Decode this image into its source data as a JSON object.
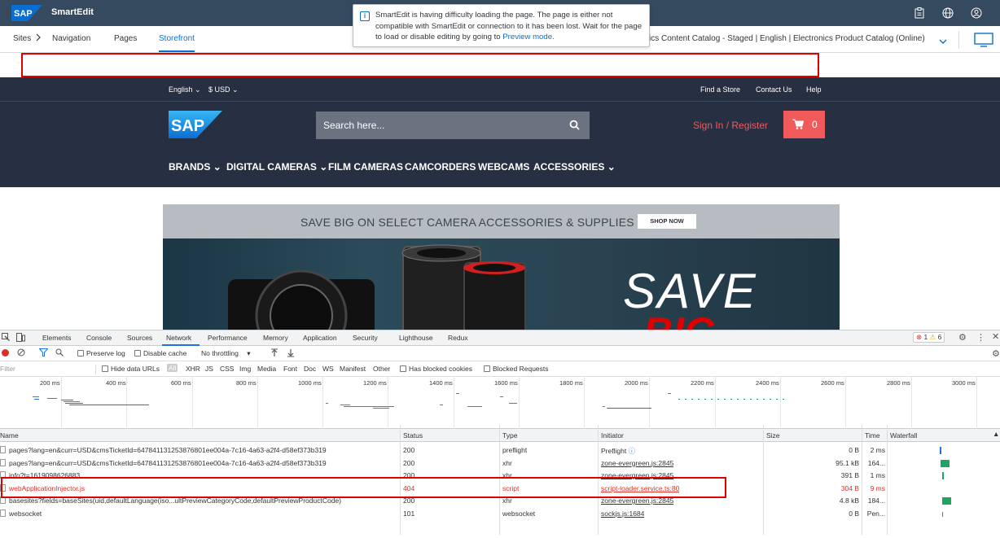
{
  "topbar": {
    "logo_text": "SAP",
    "app_title": "SmartEdit"
  },
  "navbar": {
    "sites_label": "Sites",
    "navigation_label": "Navigation",
    "pages_label": "Pages",
    "storefront_label": "Storefront",
    "catalog_text": "ics Content Catalog - Staged | English | Electronics Product Catalog (Online)"
  },
  "toast": {
    "message": "SmartEdit is having difficulty loading the page. The page is either not compatible with SmartEdit or connection to it has been lost. Wait for the page to load or disable editing by going to ",
    "link": "Preview mode."
  },
  "storefront": {
    "language": "English",
    "currency": "$ USD",
    "find_store": "Find a Store",
    "contact_us": "Contact Us",
    "help": "Help",
    "logo_text": "SAP",
    "search_placeholder": "Search here...",
    "signin": "Sign In / Register",
    "cart_count": "0",
    "categories": [
      "BRANDS",
      "DIGITAL CAMERAS",
      "FILM CAMERAS",
      "CAMCORDERS",
      "WEBCAMS",
      "ACCESSORIES"
    ],
    "banner_text": "SAVE BIG ON SELECT CAMERA ACCESSORIES & SUPPLIES",
    "shop_now": "SHOP NOW",
    "banner_save": "SAVE",
    "banner_big": "BIG"
  },
  "devtools": {
    "tabs": [
      "Elements",
      "Console",
      "Sources",
      "Network",
      "Performance",
      "Memory",
      "Application",
      "Security",
      "Lighthouse",
      "Redux"
    ],
    "active_tab": "Network",
    "error_count": "1",
    "warning_count": "6",
    "toolbar": {
      "preserve_log": "Preserve log",
      "disable_cache": "Disable cache",
      "throttling": "No throttling"
    },
    "filter": {
      "placeholder": "Filter",
      "hide_data_urls": "Hide data URLs",
      "types": [
        "All",
        "XHR",
        "JS",
        "CSS",
        "Img",
        "Media",
        "Font",
        "Doc",
        "WS",
        "Manifest",
        "Other"
      ],
      "blocked_cookies": "Has blocked cookies",
      "blocked_requests": "Blocked Requests"
    },
    "timeline_ticks": [
      "200 ms",
      "400 ms",
      "600 ms",
      "800 ms",
      "1000 ms",
      "1200 ms",
      "1400 ms",
      "1600 ms",
      "1800 ms",
      "2000 ms",
      "2200 ms",
      "2400 ms",
      "2600 ms",
      "2800 ms",
      "3000 ms"
    ],
    "columns": {
      "name": "Name",
      "status": "Status",
      "type": "Type",
      "initiator": "Initiator",
      "size": "Size",
      "time": "Time",
      "waterfall": "Waterfall"
    },
    "rows": [
      {
        "name": "pages?lang=en&curr=USD&cmsTicketId=647841131253876801ee004a-7c16-4a63-a2f4-d58ef373b319",
        "status": "200",
        "type": "preflight",
        "initiator": "Preflight",
        "size": "0 B",
        "time": "2 ms"
      },
      {
        "name": "pages?lang=en&curr=USD&cmsTicketId=647841131253876801ee004a-7c16-4a63-a2f4-d58ef373b319",
        "status": "200",
        "type": "xhr",
        "initiator": "zone-evergreen.js:2845",
        "size": "95.1 kB",
        "time": "164..."
      },
      {
        "name": "info?t=1619098626883",
        "status": "200",
        "type": "xhr",
        "initiator": "zone-evergreen.js:2845",
        "size": "391 B",
        "time": "1 ms"
      },
      {
        "name": "webApplicationInjector.js",
        "status": "404",
        "type": "script",
        "initiator": "script-loader.service.ts:80",
        "size": "304 B",
        "time": "9 ms"
      },
      {
        "name": "basesites?fields=baseSites(uid,defaultLanguage(iso...ultPreviewCategoryCode,defaultPreviewProductCode)",
        "status": "200",
        "type": "xhr",
        "initiator": "zone-evergreen.js:2845",
        "size": "4.8 kB",
        "time": "184..."
      },
      {
        "name": "websocket",
        "status": "101",
        "type": "websocket",
        "initiator": "sockjs.js:1684",
        "size": "0 B",
        "time": "Pen..."
      }
    ]
  },
  "colors": {
    "shell": "#354a5f",
    "storefront_dark": "#263042",
    "accent_red": "#f05a5a",
    "link_blue": "#0a6ed1",
    "error_red": "#d93025"
  }
}
